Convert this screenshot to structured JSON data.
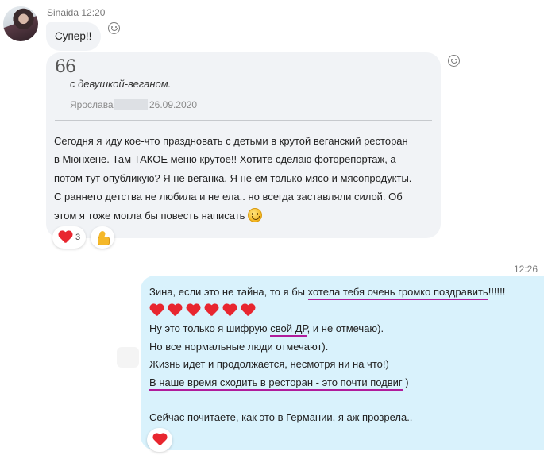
{
  "incoming": {
    "sender_name": "Sinaida",
    "time": "12:20",
    "message_1": "Супер!!",
    "quote": {
      "text": "с девушкой-веганом.",
      "author": "Ярослава",
      "date": "26.09.2020"
    },
    "message_2_lines": [
      "Сегодня я иду кое-что праздновать с детьми в крутой веганский ресторан",
      "в Мюнхене. Там ТАКОЕ меню крутое!! Хотите сделаю фоторепортаж, а",
      "потом тут опубликую? Я не веганка. Я не ем только мясо и мясопродукты.",
      "С раннего детства не любила и не ела.. но всегда заставляли силой. Об",
      "этом я тоже могла бы повесть написать"
    ],
    "reactions": {
      "heart_count": "3"
    }
  },
  "outgoing": {
    "time": "12:26",
    "line_1_before": "Зина, если это не тайна, то я бы ",
    "line_1_underlined": "хотела тебя очень громко поздравить",
    "line_1_after": "!!!!!!",
    "line_3_before": "Ну это только я шифрую ",
    "line_3_underlined": "свой ДР",
    "line_3_after": ", и не отмечаю).",
    "line_4": "Но все нормальные люди отмечают).",
    "line_5": "Жизнь идет и продолжается, несмотря ни на что!)",
    "line_6_underlined": "В наше время сходить в ресторан - это почти  подвиг",
    "line_6_after": " )",
    "line_8": "Сейчас почитаете, как это в Германии, я аж прозрела.."
  },
  "colors": {
    "incoming_bubble": "#f1f3f6",
    "outgoing_bubble": "#d9f2fc",
    "underline": "#b01c9b",
    "heart": "#e8262f"
  }
}
